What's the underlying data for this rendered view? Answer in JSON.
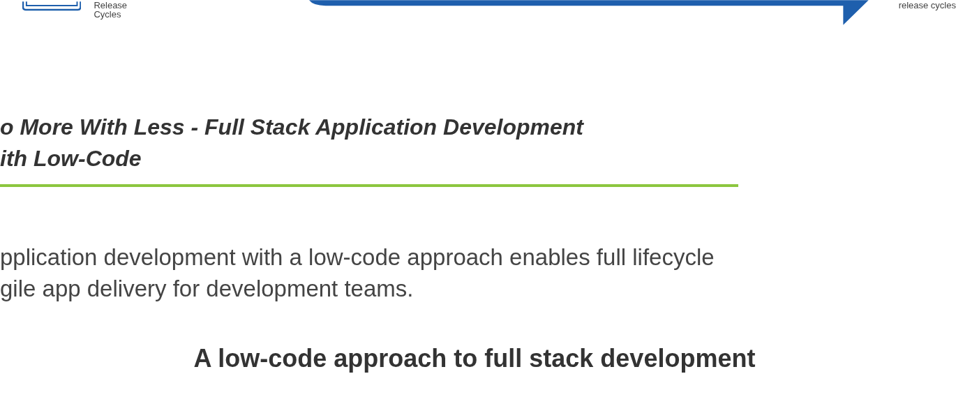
{
  "banner": {
    "left_label": "Release Cycles",
    "right_label": "release cycles"
  },
  "section": {
    "title_lines": [
      "o More With Less - Full Stack Application Development",
      "ith Low-Code"
    ],
    "paragraph_lines": [
      "pplication development with a low-code approach enables full lifecycle",
      "gile app delivery for development teams."
    ]
  },
  "subheading": "A low-code approach to full stack development"
}
